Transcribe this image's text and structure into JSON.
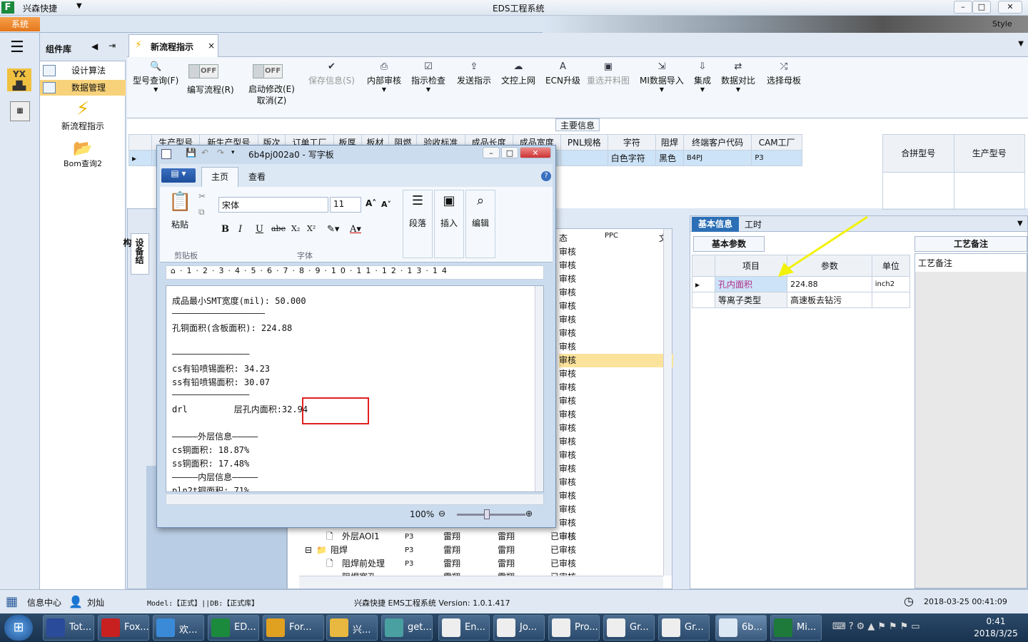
{
  "titlebar": {
    "app": "兴森快捷",
    "title": "EDS工程系统",
    "style": "Style"
  },
  "menu": {
    "system": "系统"
  },
  "leftpanel": {
    "title": "组件库",
    "items": [
      "设计算法",
      "数据管理"
    ],
    "big": [
      {
        "label": "新流程指示"
      },
      {
        "label": "Bom查询2"
      }
    ]
  },
  "tab": {
    "label": "新流程指示"
  },
  "ribbon": {
    "search": "型号查询(F)",
    "edit_flow": "编写流程(R)",
    "toggle_off": "OFF",
    "enable_mod": "启动修改(E)",
    "cancel": "取消(Z)",
    "buttons": [
      "保存信息(S)",
      "内部审核",
      "指示检查",
      "发送指示",
      "文控上网",
      "ECN升级",
      "重选开料图",
      "MI数据导入",
      "集成",
      "数据对比",
      "选择母板"
    ]
  },
  "main_info": {
    "title": "主要信息",
    "headers": [
      "生产型号",
      "新生产型号",
      "版次",
      "订单工厂",
      "板厚",
      "板材",
      "阻燃",
      "验收标准",
      "成品长度",
      "成品宽度",
      "PNL规格",
      "字符",
      "阻焊",
      "终端客户代码",
      "CAM工厂"
    ],
    "row": [
      "",
      "",
      "",
      "",
      "",
      "",
      "",
      "",
      "",
      "",
      "",
      "白色字符",
      "黑色",
      "B4PJ",
      "P3"
    ],
    "extra_headers": [
      "合拼型号",
      "生产型号"
    ]
  },
  "side": {
    "vertical_label": "设备结构"
  },
  "tree": {
    "headers": [
      "态",
      "PPC",
      "文"
    ],
    "status": "审核",
    "rows": [
      {
        "name": "外层AOI1",
        "a": "P3",
        "b": "雷翔",
        "c": "雷翔",
        "d": "已审核"
      },
      {
        "name": "阻焊",
        "a": "P3",
        "b": "雷翔",
        "c": "雷翔",
        "d": "已审核"
      },
      {
        "name": "阻焊前处理",
        "a": "P3",
        "b": "雷翔",
        "c": "雷翔",
        "d": "已审核"
      },
      {
        "name": "阻焊塞孔",
        "a": "P3",
        "b": "雷翔",
        "c": "雷翔",
        "d": "已审核"
      }
    ]
  },
  "right": {
    "tabs": [
      "基本信息",
      "工时"
    ],
    "sub": "基本参数",
    "memo_tab": "工艺备注",
    "memo_label": "工艺备注",
    "headers": [
      "项目",
      "参数",
      "单位"
    ],
    "rows": [
      {
        "item": "孔内面积",
        "val": "224.88",
        "unit": "inch2"
      },
      {
        "item": "等离子类型",
        "val": "高速板去钻污",
        "unit": ""
      }
    ]
  },
  "wordpad": {
    "title": "6b4pj002a0 - 写字板",
    "tabs": [
      "主页",
      "查看"
    ],
    "paste": "粘贴",
    "clipboard": "剪贴板",
    "font": "宋体",
    "size": "11",
    "font_group": "字体",
    "groups": [
      "段落",
      "插入",
      "编辑"
    ],
    "lines": [
      "成品最小SMT宽度(mil): 50.000",
      "——————————————————",
      "孔铜面积(含板面积): 224.88",
      "",
      "———————————————",
      "cs有铅喷锡面积: 34.23",
      "ss有铅喷锡面积: 30.07",
      "———————————————",
      "drl         层孔内面积:32.94",
      "",
      "—————外层信息—————",
      "cs铜面积: 18.87%",
      "ss铜面积: 17.48%",
      "—————内层信息—————",
      "pln2t铜面积: 71%"
    ],
    "zoom": "100%"
  },
  "status": {
    "center": "信息中心",
    "user": "刘灿",
    "model": "Model:【正式】||DB:【正式库】",
    "version": "兴森快捷 EMS工程系统 Version: 1.0.1.417",
    "datetime": "2018-03-25 00:41:09"
  },
  "taskbar": {
    "items": [
      "Tot...",
      "Fox...",
      "欢...",
      "ED...",
      "For...",
      "兴...",
      "get...",
      "En...",
      "Jo...",
      "Pro...",
      "Gr...",
      "Gr...",
      "6b...",
      "Mi..."
    ],
    "time": "0:41",
    "date": "2018/3/25"
  }
}
